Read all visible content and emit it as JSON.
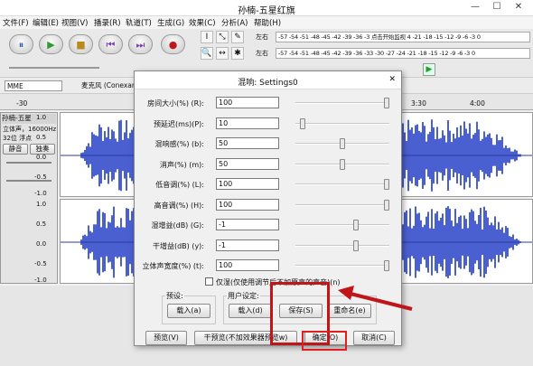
{
  "window": {
    "title": "孙楠-五星红旗",
    "minimize": "—",
    "maximize": "☐",
    "close": "✕"
  },
  "menu": [
    "文件(F)",
    "编辑(E)",
    "视图(V)",
    "播录(R)",
    "轨道(T)",
    "生成(G)",
    "效果(C)",
    "分析(A)",
    "帮助(H)"
  ],
  "transport": {
    "pause_icon": "pause-icon",
    "play_icon": "play-icon",
    "stop_icon": "stop-icon",
    "skip_start_icon": "skip-start-icon",
    "skip_end_icon": "skip-end-icon",
    "record_icon": "record-icon",
    "pause": "⏸",
    "play": "▶",
    "stop": "■",
    "skip_start": "⏮",
    "skip_end": "⏭",
    "record": "●"
  },
  "tools": {
    "select": "I",
    "envelope": "⤡",
    "draw": "✎",
    "zoom": "🔍",
    "timeshift": "↔",
    "multi": "✱"
  },
  "meters": {
    "rec_label": "左右",
    "play_label": "左右",
    "rec_scale": "-57 -54 -51 -48 -45 -42 -39 -36 -3 点击开始监视 4 -21 -18 -15 -12 -9 -6 -3 0",
    "play_scale": "-57 -54 -51 -48 -45 -42 -39 -36 -33 -30 -27 -24 -21 -18 -15 -12 -9 -6 -3 0"
  },
  "device": {
    "host": "MME",
    "input": "麦克风 (Conexan"
  },
  "ruler": {
    "ticks": [
      "-30",
      "4:00",
      "3:30",
      "4:00"
    ]
  },
  "track": {
    "name": "孙楠-五星",
    "info_1": "立体声，16000Hz",
    "info_2": "32位 浮点",
    "mute": "静音",
    "solo": "独奏",
    "scale": [
      "1.0",
      "0.5",
      "0.0",
      "-0.5",
      "-1.0",
      "1.0",
      "0.5",
      "0.0",
      "-0.5",
      "-1.0"
    ]
  },
  "dialog": {
    "title": "混响: Settings0",
    "close": "✕",
    "params": [
      {
        "label": "房间大小(%) (R):",
        "value": "100",
        "level": 1.0
      },
      {
        "label": "预延迟(ms)(P):",
        "value": "10",
        "level": 0.05
      },
      {
        "label": "混响感(%) (b):",
        "value": "50",
        "level": 0.5
      },
      {
        "label": "消声(%) (m):",
        "value": "50",
        "level": 0.5
      },
      {
        "label": "低音调(%) (L):",
        "value": "100",
        "level": 1.0
      },
      {
        "label": "高音调(%) (H):",
        "value": "100",
        "level": 1.0
      },
      {
        "label": "湿增益(dB) (G):",
        "value": "-1",
        "level": 0.65
      },
      {
        "label": "干增益(dB) (y):",
        "value": "-1",
        "level": 0.65
      },
      {
        "label": "立体声宽度(%) (t):",
        "value": "100",
        "level": 1.0
      }
    ],
    "wet_only": "仅湿(仅使用调节后不加原声的声音)(n)",
    "preset_label": "预设:",
    "preset_load": "载入(a)",
    "user_label": "用户设定:",
    "user_load": "载入(d)",
    "user_save": "保存(S)",
    "user_rename": "重命名(e)",
    "preview": "预览(V)",
    "dry_preview": "干预览(不加效果器预览w)",
    "ok": "确定(O)",
    "cancel": "取消(C)"
  }
}
